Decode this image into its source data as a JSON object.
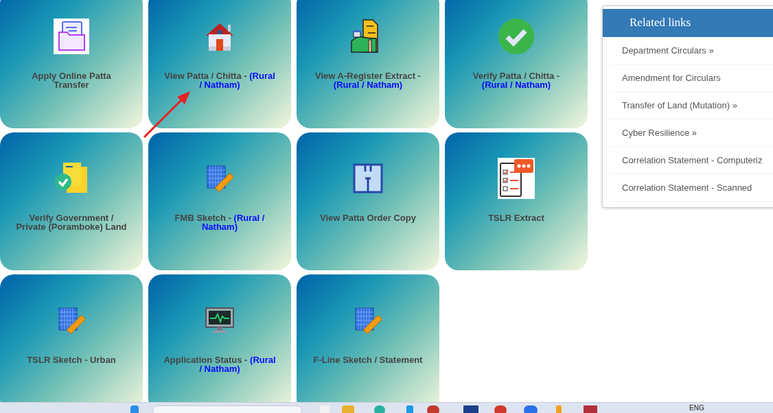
{
  "tiles": [
    {
      "kind": "folder-doc",
      "label": "Apply Online Patta Transfer"
    },
    {
      "kind": "house",
      "label": "View Patta / Chitta - ",
      "highlight": "(Rural / Natham)"
    },
    {
      "kind": "land-doc",
      "label": "View A-Register Extract - ",
      "highlight": "(Rural / Natham)"
    },
    {
      "kind": "check-circle",
      "label": "Verify Patta / Chitta - ",
      "highlight": "(Rural / Natham)"
    },
    {
      "kind": "doc-check",
      "label": "Verify Government / Private (Poramboke) Land"
    },
    {
      "kind": "blueprint",
      "label": "FMB Sketch - ",
      "highlight": "(Rural / Natham)"
    },
    {
      "kind": "floorplan",
      "label": "View Patta Order Copy"
    },
    {
      "kind": "checklist",
      "label": "TSLR Extract"
    },
    {
      "kind": "blueprint",
      "label": "TSLR Sketch - Urban"
    },
    {
      "kind": "monitor",
      "label": "Application Status - ",
      "highlight": "(Rural / Natham)"
    },
    {
      "kind": "blueprint",
      "label": "F-Line Sketch / Statement"
    }
  ],
  "related_links": {
    "title": "Related links",
    "items": [
      "Department Circulars »",
      "Amendment for Circulars",
      "Transfer of Land (Mutation) »",
      "Cyber Resilience »",
      "Correlation Statement - Computeriz",
      "Correlation Statement - Scanned"
    ]
  },
  "taskbar": {
    "language": "ENG"
  }
}
